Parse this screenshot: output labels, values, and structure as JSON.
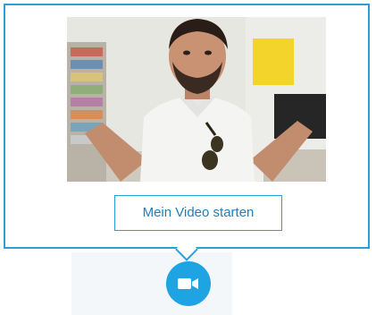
{
  "popup": {
    "start_video_label": "Mein Video starten"
  },
  "colors": {
    "accent": "#27a0dc",
    "call_button": "#1ea4e3",
    "button_text": "#1e7fba"
  },
  "icons": {
    "call_button_icon": "video-camera-icon"
  }
}
